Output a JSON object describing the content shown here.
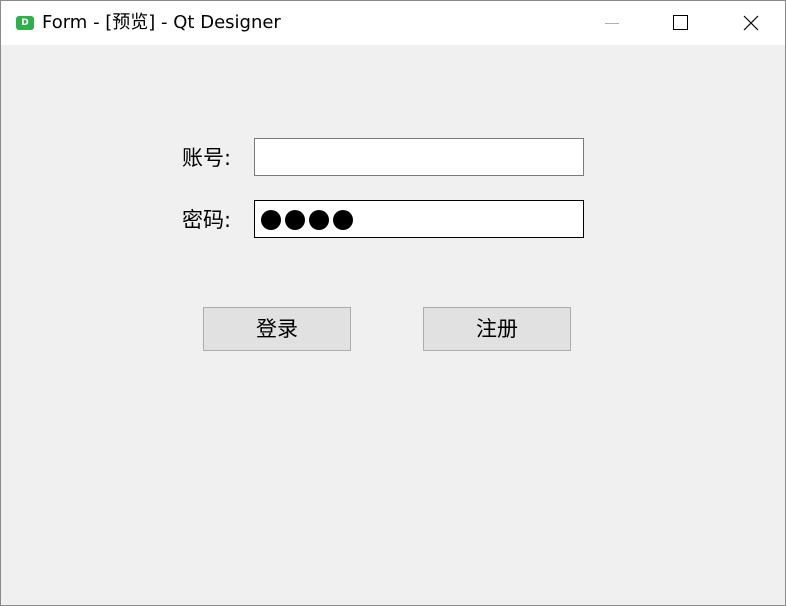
{
  "window": {
    "title": "Form - [预览] - Qt Designer",
    "app_icon_letter": "D",
    "controls": {
      "minimize_icon": "minimize-icon",
      "maximize_icon": "maximize-icon",
      "close_icon": "close-icon"
    }
  },
  "form": {
    "account_label": "账号:",
    "account_value": "",
    "password_label": "密码:",
    "password_dot_count": 4,
    "login_label": "登录",
    "register_label": "注册"
  },
  "colors": {
    "client_bg": "#f0f0f0",
    "titlebar_bg": "#ffffff",
    "button_bg": "#e1e1e1",
    "app_icon": "#2fb04a"
  }
}
